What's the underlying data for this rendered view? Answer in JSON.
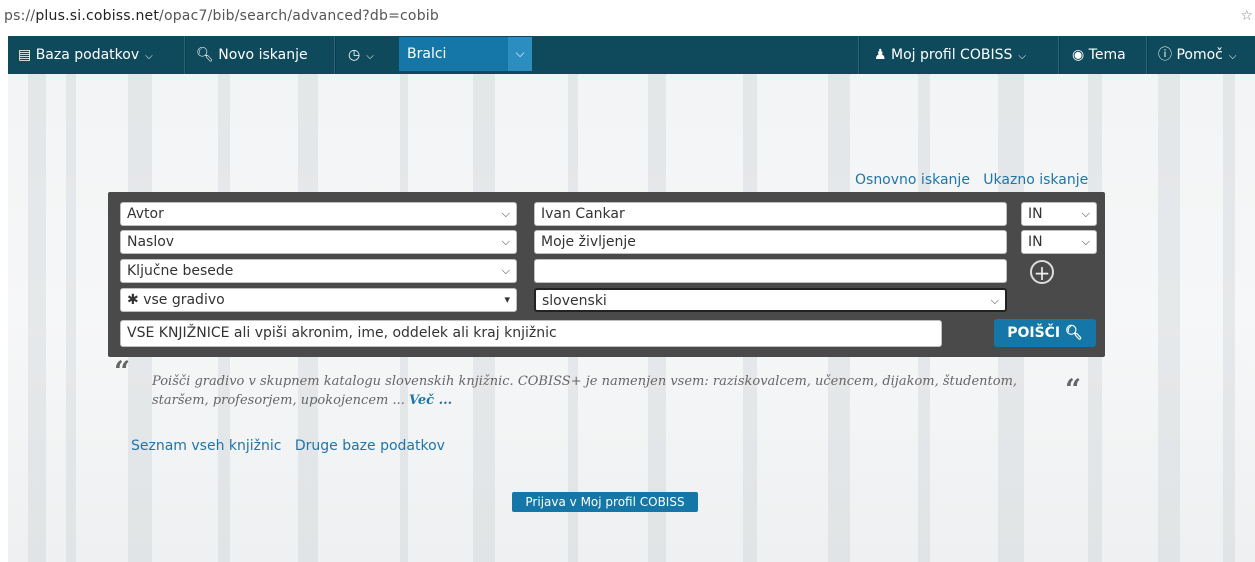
{
  "browser": {
    "url_prefix": "ps://",
    "url_host": "plus.si.cobiss.net",
    "url_path": "/opac7/bib/search/advanced?db=cobib"
  },
  "nav": {
    "database_label": "Baza podatkov",
    "new_search_label": "Novo iskanje",
    "library_select_value": "Bralci",
    "profile_label": "Moj profil COBISS",
    "theme_label": "Tema",
    "help_label": "Pomoč"
  },
  "search_mode": {
    "basic": "Osnovno iskanje",
    "command": "Ukazno iskanje"
  },
  "rows": [
    {
      "field": "Avtor",
      "value": "Ivan Cankar",
      "operator": "IN"
    },
    {
      "field": "Naslov",
      "value": "Moje življenje",
      "operator": "IN"
    },
    {
      "field": "Ključne besede",
      "value": ""
    }
  ],
  "filters": {
    "material": "vse gradivo",
    "language": "slovenski"
  },
  "library_input": {
    "placeholder": "VSE KNJIŽNICE ali vpiši akronim, ime, oddelek ali kraj knjižnic"
  },
  "search_button": "POIŠČI",
  "quote": {
    "text": "Poišči gradivo v skupnem katalogu slovenskih knjižnic. COBISS+ je namenjen vsem: raziskovalcem, učencem, dijakom, študentom, staršem, profesorjem, upokojencem ...",
    "more": "Več ..."
  },
  "bottom_links": {
    "all_libraries": "Seznam vseh knjižnic",
    "other_databases": "Druge baze podatkov"
  },
  "login_button": "Prijava v Moj profil COBISS",
  "colors": {
    "nav_bg": "#0e4a5c",
    "accent": "#1577a7",
    "link": "#1f75a8",
    "panel_bg": "#4a4a4a"
  }
}
